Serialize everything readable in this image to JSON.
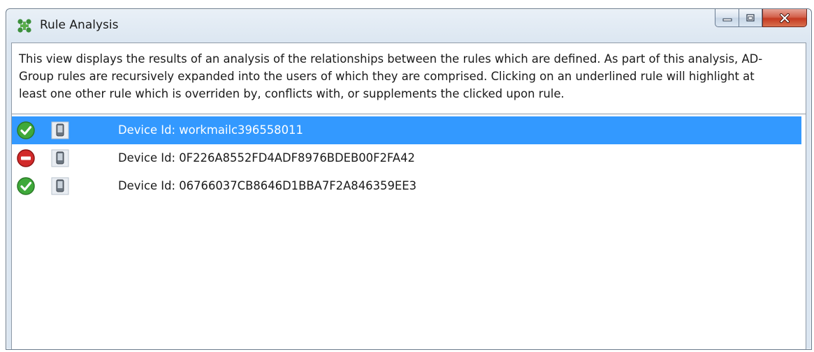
{
  "window": {
    "title": "Rule Analysis",
    "controls": {
      "minimize": "minimize-icon",
      "maximize": "maximize-icon",
      "close": "close-icon"
    }
  },
  "description": "This view displays the results of an analysis of the relationships between the rules which are defined. As part of this analysis, AD-Group rules are recursively expanded into the users of which they are comprised. Clicking on an underlined rule will highlight at least one other rule which is overriden by, conflicts with, or supplements the clicked upon rule.",
  "rules": [
    {
      "status": "allowed",
      "status_icon": "checkmark-icon",
      "device_icon": "device-icon",
      "label": "Device Id: workmailc396558011",
      "selected": true
    },
    {
      "status": "denied",
      "status_icon": "no-entry-icon",
      "device_icon": "device-icon",
      "label": "Device Id: 0F226A8552FD4ADF8976BDEB00F2FA42",
      "selected": false
    },
    {
      "status": "allowed",
      "status_icon": "checkmark-icon",
      "device_icon": "device-icon",
      "label": "Device Id: 06766037CB8646D1BBA7F2A846359EE3",
      "selected": false
    }
  ],
  "colors": {
    "selection": "#3399ff",
    "allowed": "#3fa93a",
    "denied": "#d22a2a"
  }
}
